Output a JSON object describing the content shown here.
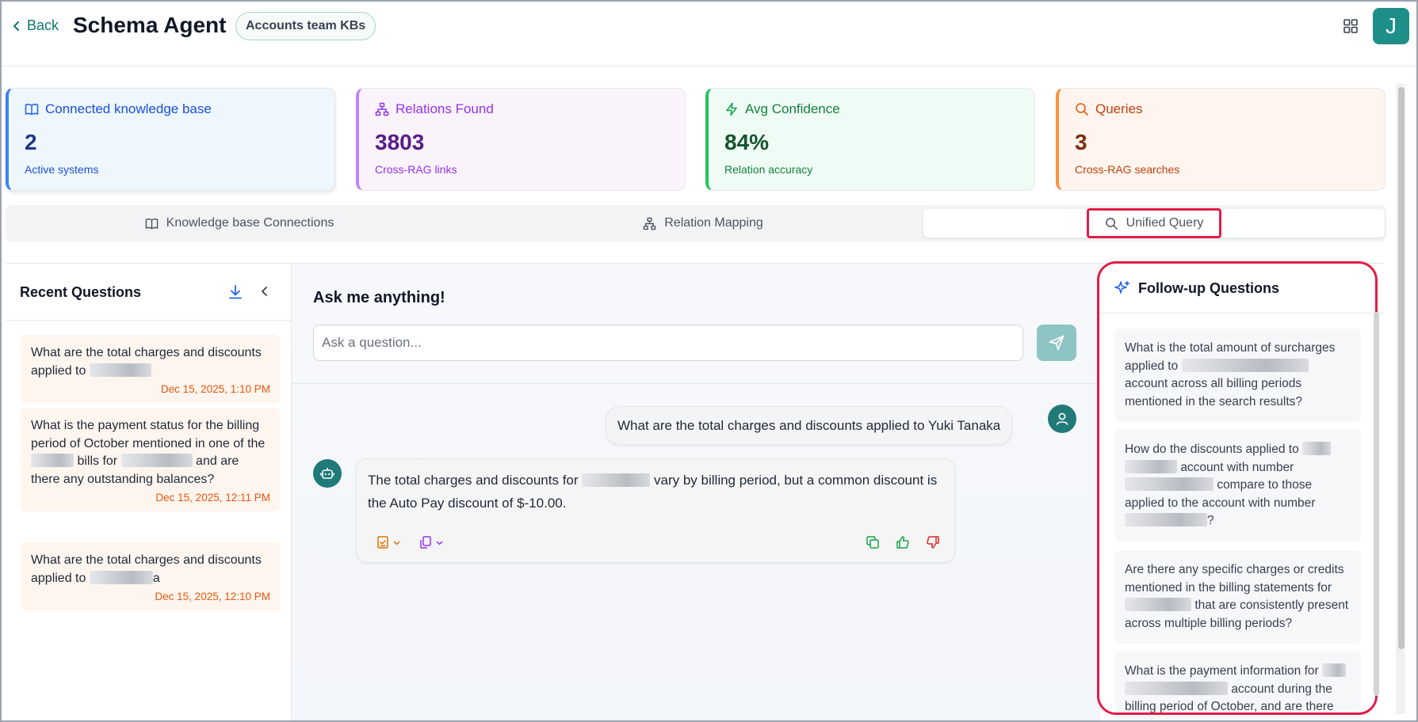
{
  "header": {
    "back_label": "Back",
    "title": "Schema Agent",
    "kb_badge": "Accounts team KBs",
    "avatar_letter": "J"
  },
  "stats": [
    {
      "title": "Connected knowledge base",
      "value": "2",
      "sub": "Active systems",
      "icon": "book-open-icon"
    },
    {
      "title": "Relations Found",
      "value": "3803",
      "sub": "Cross-RAG links",
      "icon": "network-icon"
    },
    {
      "title": "Avg Confidence",
      "value": "84%",
      "sub": "Relation accuracy",
      "icon": "lightning-icon"
    },
    {
      "title": "Queries",
      "value": "3",
      "sub": "Cross-RAG searches",
      "icon": "search-icon"
    }
  ],
  "tabs": [
    {
      "label": "Knowledge base Connections",
      "icon": "book-open-icon",
      "active": false
    },
    {
      "label": "Relation Mapping",
      "icon": "network-icon",
      "active": false
    },
    {
      "label": "Unified Query",
      "icon": "search-icon",
      "active": true
    }
  ],
  "recent": {
    "title": "Recent Questions",
    "items": [
      {
        "q_prefix": "What are the total charges and discounts applied to",
        "date": "Dec 15, 2025, 1:10 PM"
      },
      {
        "q_a": "What is the payment status for the billing period of October mentioned in one of the",
        "q_b": "bills for",
        "q_c": "and are there any outstanding balances?",
        "date": "Dec 15, 2025, 12:11 PM"
      },
      {
        "q_prefix": "What are the total charges and discounts applied to",
        "q_suffix": "a",
        "date": "Dec 15, 2025, 12:10 PM"
      }
    ]
  },
  "chat": {
    "heading": "Ask me anything!",
    "placeholder": "Ask a question...",
    "user_message": "What are the total charges and discounts applied to Yuki Tanaka",
    "bot_a": "The total charges and discounts for",
    "bot_b": "vary by billing period, but a common discount is the Auto Pay discount of $-10.00."
  },
  "followup": {
    "title": "Follow-up Questions",
    "items": [
      {
        "a": "What is the total amount of surcharges applied to",
        "b": "account across all billing periods mentioned in the search results?"
      },
      {
        "a": "How do the discounts applied to",
        "b": "account with number",
        "c": "compare to those applied to the account with number",
        "d": "?"
      },
      {
        "a": "Are there any specific charges or credits mentioned in the billing statements for",
        "b": "that are consistently present across multiple billing periods?"
      },
      {
        "a": "What is the payment information for",
        "b": "account during the billing period of October, and are there"
      }
    ]
  },
  "colors": {
    "accent_teal": "#1f8f8a",
    "highlight_red": "#e11d48",
    "date_orange": "#ea580c"
  }
}
